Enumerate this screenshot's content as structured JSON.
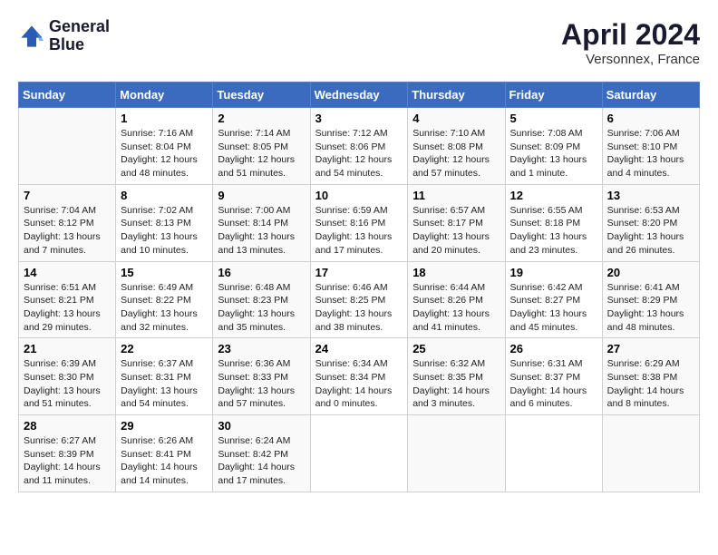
{
  "logo": {
    "line1": "General",
    "line2": "Blue"
  },
  "title": "April 2024",
  "location": "Versonnex, France",
  "header_days": [
    "Sunday",
    "Monday",
    "Tuesday",
    "Wednesday",
    "Thursday",
    "Friday",
    "Saturday"
  ],
  "weeks": [
    [
      {
        "day": "",
        "sunrise": "",
        "sunset": "",
        "daylight": ""
      },
      {
        "day": "1",
        "sunrise": "Sunrise: 7:16 AM",
        "sunset": "Sunset: 8:04 PM",
        "daylight": "Daylight: 12 hours and 48 minutes."
      },
      {
        "day": "2",
        "sunrise": "Sunrise: 7:14 AM",
        "sunset": "Sunset: 8:05 PM",
        "daylight": "Daylight: 12 hours and 51 minutes."
      },
      {
        "day": "3",
        "sunrise": "Sunrise: 7:12 AM",
        "sunset": "Sunset: 8:06 PM",
        "daylight": "Daylight: 12 hours and 54 minutes."
      },
      {
        "day": "4",
        "sunrise": "Sunrise: 7:10 AM",
        "sunset": "Sunset: 8:08 PM",
        "daylight": "Daylight: 12 hours and 57 minutes."
      },
      {
        "day": "5",
        "sunrise": "Sunrise: 7:08 AM",
        "sunset": "Sunset: 8:09 PM",
        "daylight": "Daylight: 13 hours and 1 minute."
      },
      {
        "day": "6",
        "sunrise": "Sunrise: 7:06 AM",
        "sunset": "Sunset: 8:10 PM",
        "daylight": "Daylight: 13 hours and 4 minutes."
      }
    ],
    [
      {
        "day": "7",
        "sunrise": "Sunrise: 7:04 AM",
        "sunset": "Sunset: 8:12 PM",
        "daylight": "Daylight: 13 hours and 7 minutes."
      },
      {
        "day": "8",
        "sunrise": "Sunrise: 7:02 AM",
        "sunset": "Sunset: 8:13 PM",
        "daylight": "Daylight: 13 hours and 10 minutes."
      },
      {
        "day": "9",
        "sunrise": "Sunrise: 7:00 AM",
        "sunset": "Sunset: 8:14 PM",
        "daylight": "Daylight: 13 hours and 13 minutes."
      },
      {
        "day": "10",
        "sunrise": "Sunrise: 6:59 AM",
        "sunset": "Sunset: 8:16 PM",
        "daylight": "Daylight: 13 hours and 17 minutes."
      },
      {
        "day": "11",
        "sunrise": "Sunrise: 6:57 AM",
        "sunset": "Sunset: 8:17 PM",
        "daylight": "Daylight: 13 hours and 20 minutes."
      },
      {
        "day": "12",
        "sunrise": "Sunrise: 6:55 AM",
        "sunset": "Sunset: 8:18 PM",
        "daylight": "Daylight: 13 hours and 23 minutes."
      },
      {
        "day": "13",
        "sunrise": "Sunrise: 6:53 AM",
        "sunset": "Sunset: 8:20 PM",
        "daylight": "Daylight: 13 hours and 26 minutes."
      }
    ],
    [
      {
        "day": "14",
        "sunrise": "Sunrise: 6:51 AM",
        "sunset": "Sunset: 8:21 PM",
        "daylight": "Daylight: 13 hours and 29 minutes."
      },
      {
        "day": "15",
        "sunrise": "Sunrise: 6:49 AM",
        "sunset": "Sunset: 8:22 PM",
        "daylight": "Daylight: 13 hours and 32 minutes."
      },
      {
        "day": "16",
        "sunrise": "Sunrise: 6:48 AM",
        "sunset": "Sunset: 8:23 PM",
        "daylight": "Daylight: 13 hours and 35 minutes."
      },
      {
        "day": "17",
        "sunrise": "Sunrise: 6:46 AM",
        "sunset": "Sunset: 8:25 PM",
        "daylight": "Daylight: 13 hours and 38 minutes."
      },
      {
        "day": "18",
        "sunrise": "Sunrise: 6:44 AM",
        "sunset": "Sunset: 8:26 PM",
        "daylight": "Daylight: 13 hours and 41 minutes."
      },
      {
        "day": "19",
        "sunrise": "Sunrise: 6:42 AM",
        "sunset": "Sunset: 8:27 PM",
        "daylight": "Daylight: 13 hours and 45 minutes."
      },
      {
        "day": "20",
        "sunrise": "Sunrise: 6:41 AM",
        "sunset": "Sunset: 8:29 PM",
        "daylight": "Daylight: 13 hours and 48 minutes."
      }
    ],
    [
      {
        "day": "21",
        "sunrise": "Sunrise: 6:39 AM",
        "sunset": "Sunset: 8:30 PM",
        "daylight": "Daylight: 13 hours and 51 minutes."
      },
      {
        "day": "22",
        "sunrise": "Sunrise: 6:37 AM",
        "sunset": "Sunset: 8:31 PM",
        "daylight": "Daylight: 13 hours and 54 minutes."
      },
      {
        "day": "23",
        "sunrise": "Sunrise: 6:36 AM",
        "sunset": "Sunset: 8:33 PM",
        "daylight": "Daylight: 13 hours and 57 minutes."
      },
      {
        "day": "24",
        "sunrise": "Sunrise: 6:34 AM",
        "sunset": "Sunset: 8:34 PM",
        "daylight": "Daylight: 14 hours and 0 minutes."
      },
      {
        "day": "25",
        "sunrise": "Sunrise: 6:32 AM",
        "sunset": "Sunset: 8:35 PM",
        "daylight": "Daylight: 14 hours and 3 minutes."
      },
      {
        "day": "26",
        "sunrise": "Sunrise: 6:31 AM",
        "sunset": "Sunset: 8:37 PM",
        "daylight": "Daylight: 14 hours and 6 minutes."
      },
      {
        "day": "27",
        "sunrise": "Sunrise: 6:29 AM",
        "sunset": "Sunset: 8:38 PM",
        "daylight": "Daylight: 14 hours and 8 minutes."
      }
    ],
    [
      {
        "day": "28",
        "sunrise": "Sunrise: 6:27 AM",
        "sunset": "Sunset: 8:39 PM",
        "daylight": "Daylight: 14 hours and 11 minutes."
      },
      {
        "day": "29",
        "sunrise": "Sunrise: 6:26 AM",
        "sunset": "Sunset: 8:41 PM",
        "daylight": "Daylight: 14 hours and 14 minutes."
      },
      {
        "day": "30",
        "sunrise": "Sunrise: 6:24 AM",
        "sunset": "Sunset: 8:42 PM",
        "daylight": "Daylight: 14 hours and 17 minutes."
      },
      {
        "day": "",
        "sunrise": "",
        "sunset": "",
        "daylight": ""
      },
      {
        "day": "",
        "sunrise": "",
        "sunset": "",
        "daylight": ""
      },
      {
        "day": "",
        "sunrise": "",
        "sunset": "",
        "daylight": ""
      },
      {
        "day": "",
        "sunrise": "",
        "sunset": "",
        "daylight": ""
      }
    ]
  ]
}
